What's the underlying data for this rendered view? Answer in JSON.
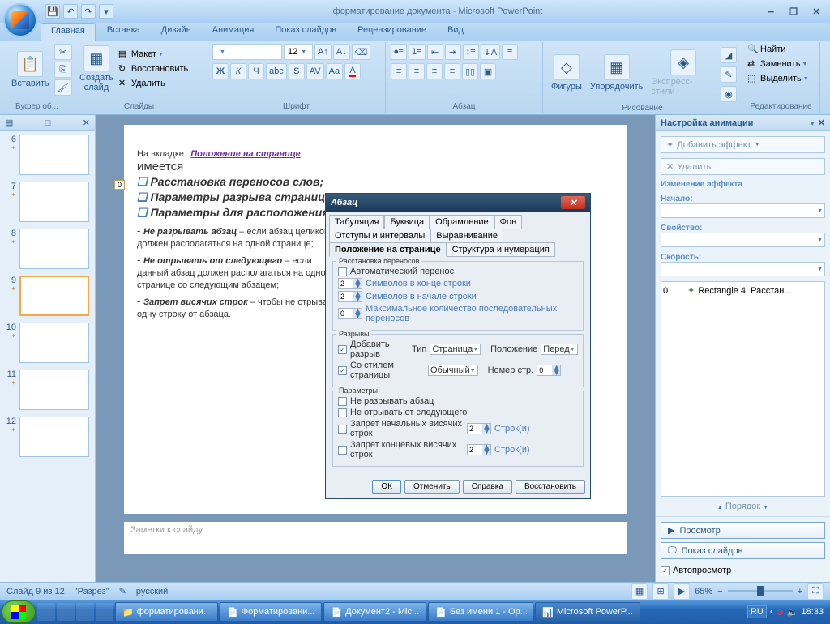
{
  "titlebar": {
    "title": "форматирование документа - Microsoft PowerPoint"
  },
  "tabs": [
    "Главная",
    "Вставка",
    "Дизайн",
    "Анимация",
    "Показ слайдов",
    "Рецензирование",
    "Вид"
  ],
  "activeTab": 0,
  "ribbon": {
    "clipboard": {
      "label": "Буфер об...",
      "paste": "Вставить"
    },
    "slides": {
      "label": "Слайды",
      "new": "Создать\nслайд",
      "layout": "Макет",
      "reset": "Восстановить",
      "delete": "Удалить"
    },
    "font": {
      "label": "Шрифт",
      "size": "12"
    },
    "paragraph": {
      "label": "Абзац"
    },
    "drawing": {
      "label": "Рисование",
      "shapes": "Фигуры",
      "arrange": "Упорядочить",
      "quickstyles": "Экспресс-стили"
    },
    "editing": {
      "label": "Редактирование",
      "find": "Найти",
      "replace": "Заменить",
      "select": "Выделить"
    }
  },
  "thumbs": [
    {
      "n": 6
    },
    {
      "n": 7
    },
    {
      "n": 8
    },
    {
      "n": 9,
      "sel": true
    },
    {
      "n": 10
    },
    {
      "n": 11
    },
    {
      "n": 12
    }
  ],
  "slide": {
    "head_prefix": "На вкладке",
    "head_tab": "Положение на странице",
    "head_suffix": "имеется",
    "items": [
      "Расстановка переносов слов;",
      "Параметры разрыва страницы;",
      "Параметры для расположения абзацев"
    ],
    "body1_b": "Не разрывать абзац",
    "body1": " – если абзац целиком должен располагаться на одной странице;",
    "body2_b": "Не отрывать от следующего",
    "body2": " – если данный абзац должен располагаться на одной странице со следующим абзацем;",
    "body3_b": "Запрет висячих строк",
    "body3": " – чтобы не отрывать одну строку от абзаца.",
    "tag": "0"
  },
  "notes": "Заметки к слайду",
  "dialog": {
    "title": "Абзац",
    "tabs_row1": [
      "Табуляция",
      "Буквица",
      "Обрамление",
      "Фон"
    ],
    "tabs_row2": [
      "Отступы и интервалы",
      "Выравнивание",
      "Положение на странице",
      "Структура и нумерация"
    ],
    "activeTab": "Положение на странице",
    "hyphen": {
      "title": "Расстановка переносов",
      "auto": "Автоматический перенос",
      "l1": "Символов в конце строки",
      "l2": "Символов в начале строки",
      "l3": "Максимальное количество последовательных переносов",
      "v1": "2",
      "v2": "2",
      "v3": "0"
    },
    "breaks": {
      "title": "Разрывы",
      "add": "Добавить разрыв",
      "type": "Тип",
      "type_v": "Страница",
      "style": "Со стилем страницы",
      "style_v": "Обычный",
      "pos": "Положение",
      "pos_v": "Перед",
      "page": "Номер стр.",
      "page_v": "0"
    },
    "params": {
      "title": "Параметры",
      "p1": "Не разрывать абзац",
      "p2": "Не отрывать от следующего",
      "p3": "Запрет начальных висячих строк",
      "p4": "Запрет концевых висячих строк",
      "lines": "Строк(и)",
      "v": "2"
    },
    "btns": {
      "ok": "ОК",
      "cancel": "Отменить",
      "help": "Справка",
      "reset": "Восстановить"
    }
  },
  "anim": {
    "title": "Настройка анимации",
    "add": "Добавить эффект",
    "del": "Удалить",
    "change": "Изменение эффекта",
    "start": "Начало:",
    "prop": "Свойство:",
    "speed": "Скорость:",
    "item": {
      "n": "0",
      "text": "Rectangle 4: Расстан..."
    },
    "order": "Порядок",
    "preview": "Просмотр",
    "slideshow": "Показ слайдов",
    "autoprev": "Автопросмотр"
  },
  "status": {
    "slide": "Слайд 9 из 12",
    "theme": "\"Разрез\"",
    "lang": "русский",
    "zoom": "65%"
  },
  "taskbar": {
    "items": [
      {
        "t": "форматировани...",
        "icon": "📁"
      },
      {
        "t": "Форматировани...",
        "icon": "📄"
      },
      {
        "t": "Документ2 - Mic...",
        "icon": "📄"
      },
      {
        "t": "Без имени 1 - Op...",
        "icon": "📄"
      },
      {
        "t": "Microsoft PowerP...",
        "icon": "📊",
        "active": true
      }
    ],
    "lang": "RU",
    "time": "18:33"
  }
}
